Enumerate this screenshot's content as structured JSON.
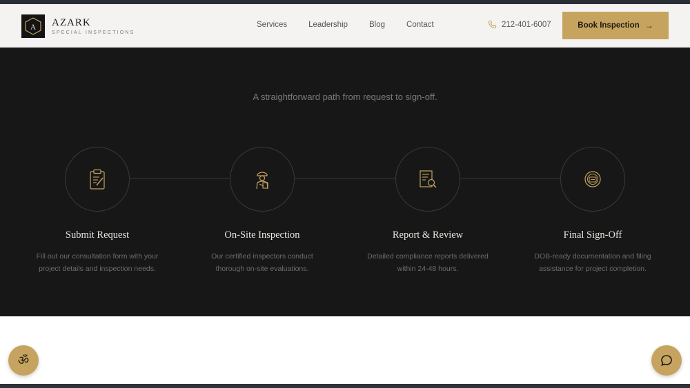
{
  "brand": {
    "name": "AZARK",
    "tagline": "SPECIAL INSPECTIONS",
    "mark_letter": "A",
    "accent": "#c6a45f"
  },
  "nav": {
    "items": [
      "Services",
      "Leadership",
      "Blog",
      "Contact"
    ]
  },
  "header": {
    "phone": "212-401-6007",
    "cta_label": "Book Inspection"
  },
  "process": {
    "subtitle": "A straightforward path from request to sign-off.",
    "steps": [
      {
        "title": "Submit Request",
        "desc": "Fill out our consultation form with your project details and inspection needs.",
        "icon": "clipboard-icon"
      },
      {
        "title": "On-Site Inspection",
        "desc": "Our certified inspectors conduct thorough on-site evaluations.",
        "icon": "inspector-icon"
      },
      {
        "title": "Report & Review",
        "desc": "Detailed compliance reports delivered within 24-48 hours.",
        "icon": "report-search-icon"
      },
      {
        "title": "Final Sign-Off",
        "desc": "DOB-ready documentation and filing assistance for project completion.",
        "icon": "seal-icon"
      }
    ]
  },
  "widgets": {
    "accessibility_glyph": "ॐ"
  }
}
